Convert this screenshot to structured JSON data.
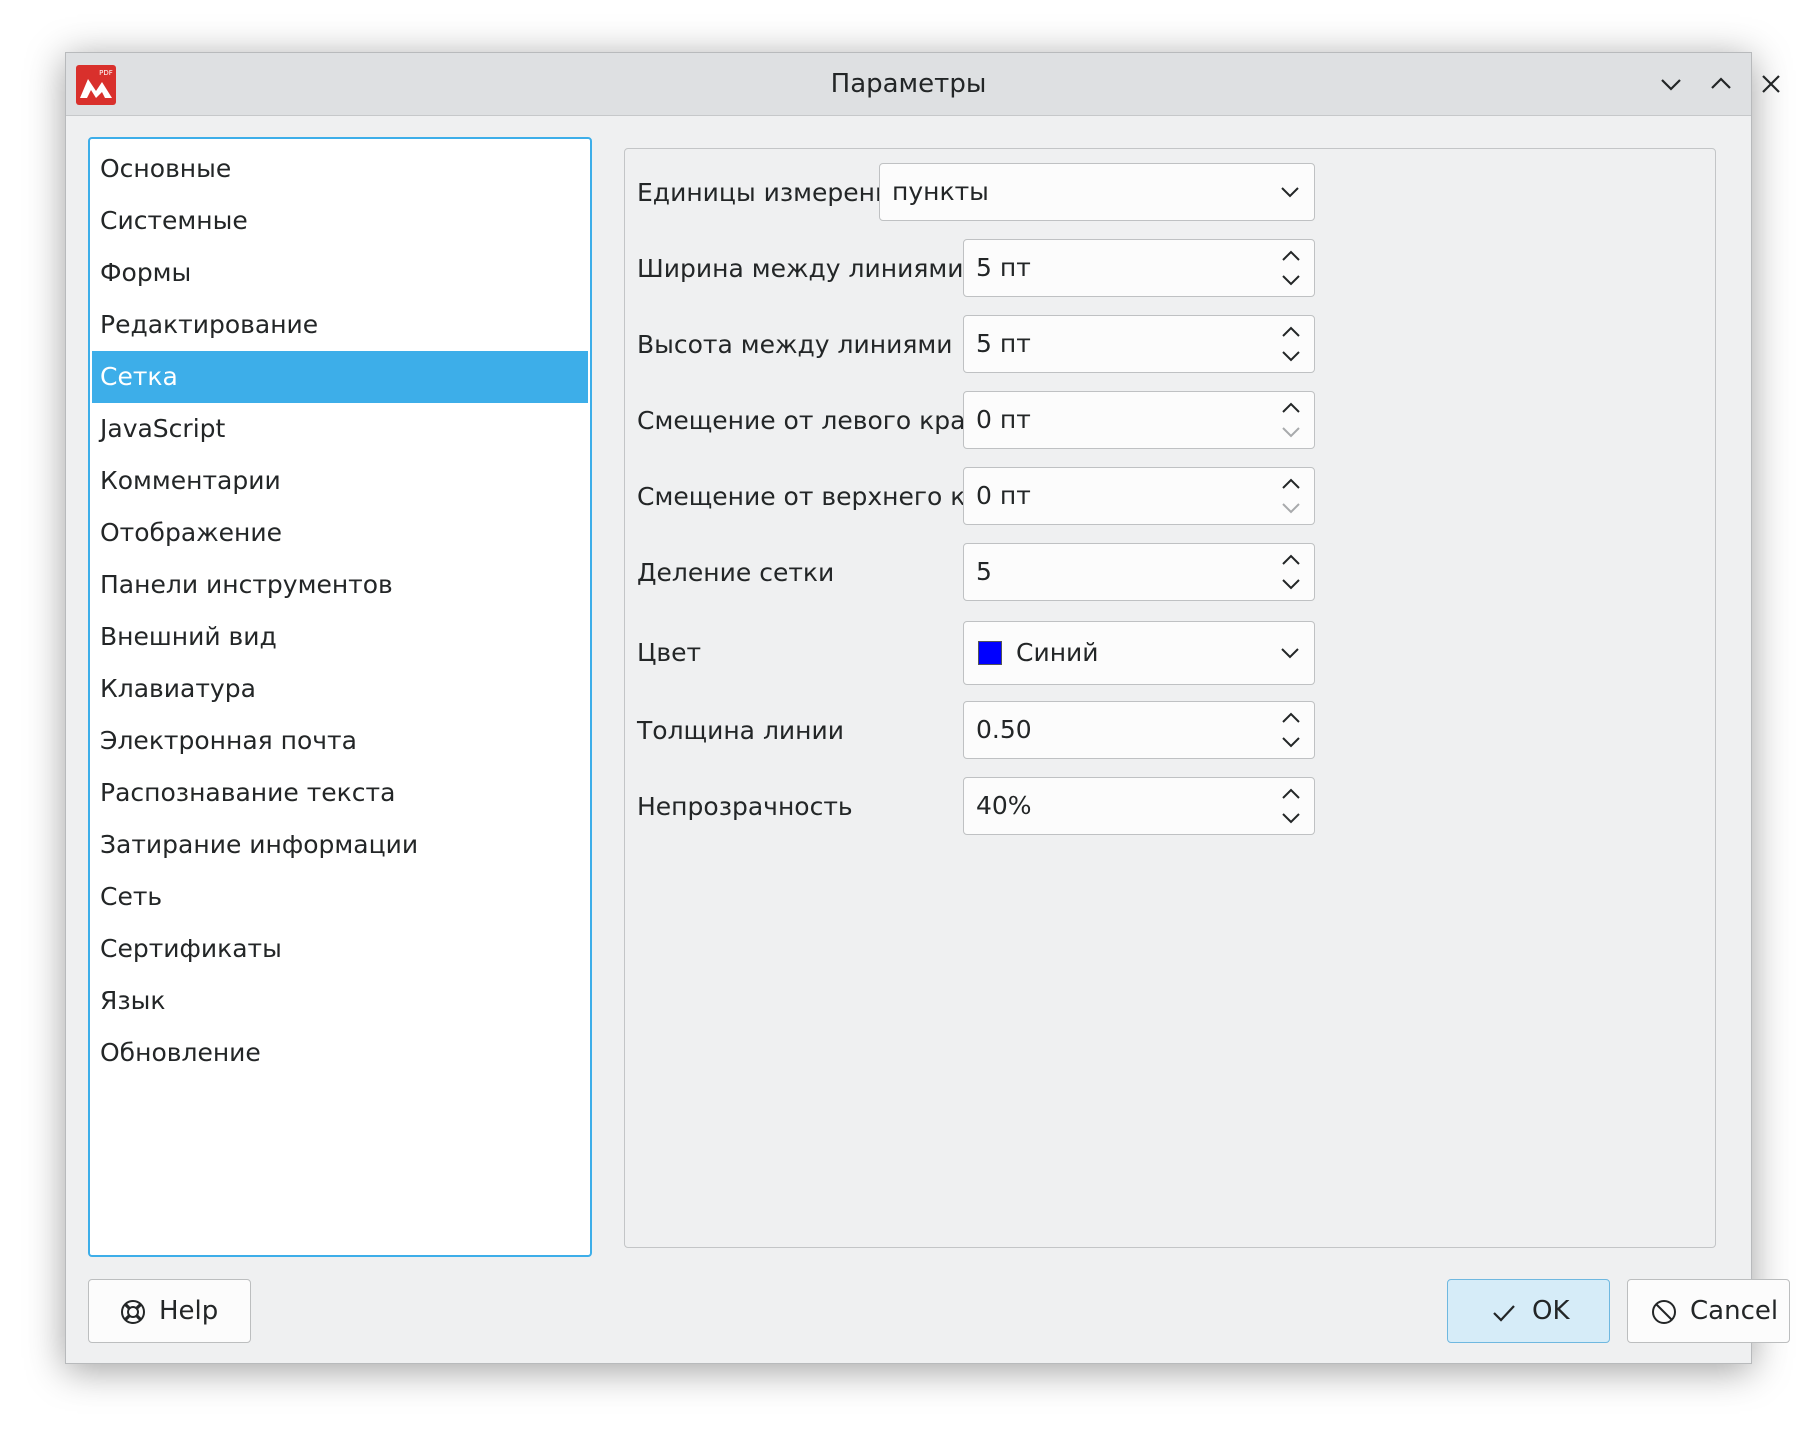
{
  "window": {
    "title": "Параметры",
    "app_icon": "pdf-app-icon",
    "controls": [
      "minimize-icon",
      "maximize-icon",
      "close-icon"
    ]
  },
  "sidebar": {
    "items": [
      {
        "label": "Основные"
      },
      {
        "label": "Системные"
      },
      {
        "label": "Формы"
      },
      {
        "label": "Редактирование"
      },
      {
        "label": "Сетка",
        "selected": true
      },
      {
        "label": "JavaScript"
      },
      {
        "label": "Комментарии"
      },
      {
        "label": "Отображение"
      },
      {
        "label": "Панели инструментов"
      },
      {
        "label": "Внешний вид"
      },
      {
        "label": "Клавиатура"
      },
      {
        "label": "Электронная почта"
      },
      {
        "label": "Распознавание текста"
      },
      {
        "label": "Затирание информации"
      },
      {
        "label": "Сеть"
      },
      {
        "label": "Сертификаты"
      },
      {
        "label": "Язык"
      },
      {
        "label": "Обновление"
      }
    ]
  },
  "grid_settings": {
    "units": {
      "label": "Единицы измерения",
      "value": "пункты"
    },
    "width_between_lines": {
      "label": "Ширина между линиями",
      "value": "5 пт"
    },
    "height_between_lines": {
      "label": "Высота между линиями",
      "value": "5 пт"
    },
    "left_offset": {
      "label": "Смещение от левого края",
      "value": "0 пт"
    },
    "top_offset": {
      "label": "Смещение от верхнего края",
      "value": "0 пт"
    },
    "subdivisions": {
      "label": "Деление сетки",
      "value": "5"
    },
    "color": {
      "label": "Цвет",
      "value": "Синий",
      "swatch": "#0000ff"
    },
    "line_thickness": {
      "label": "Толщина линии",
      "value": "0.50"
    },
    "opacity": {
      "label": "Непрозрачность",
      "value": "40%"
    }
  },
  "buttons": {
    "help": {
      "label": "Help",
      "icon": "lifebuoy-icon"
    },
    "ok": {
      "label": "OK",
      "icon": "checkmark-icon"
    },
    "cancel": {
      "label": "Cancel",
      "icon": "cancel-icon"
    }
  },
  "colors": {
    "accent": "#3daee9",
    "window_bg": "#eff0f1"
  }
}
